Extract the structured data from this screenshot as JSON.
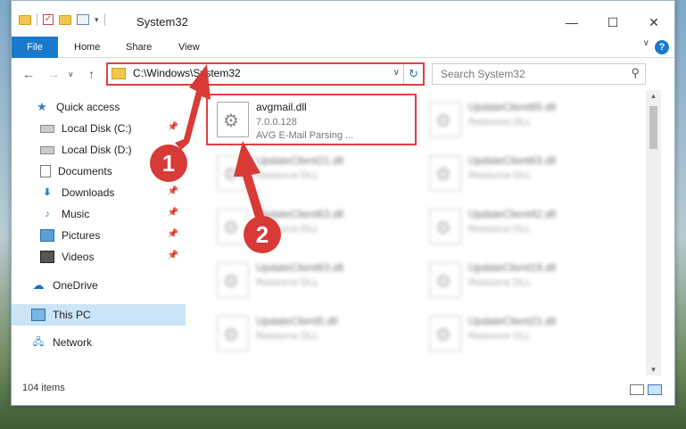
{
  "window": {
    "title": "System32",
    "minimize": "—",
    "maximize": "☐",
    "close": "✕"
  },
  "ribbon": {
    "tabs": [
      "File",
      "Home",
      "Share",
      "View"
    ],
    "help": "?",
    "expand": "∨"
  },
  "address": {
    "path": "C:\\Windows\\System32",
    "dropdown": "∨",
    "refresh": "↻"
  },
  "nav_buttons": {
    "back": "←",
    "forward": "→",
    "recent": "∨",
    "up": "↑"
  },
  "search": {
    "placeholder": "Search System32",
    "icon": "search-icon"
  },
  "navpane": {
    "items": [
      {
        "label": "Quick access",
        "icon": "star-icon",
        "pinned": false
      },
      {
        "label": "Local Disk (C:)",
        "icon": "disk-icon",
        "pinned": true
      },
      {
        "label": "Local Disk (D:)",
        "icon": "disk-icon",
        "pinned": false
      },
      {
        "label": "Documents",
        "icon": "documents-icon",
        "pinned": true
      },
      {
        "label": "Downloads",
        "icon": "download-icon",
        "pinned": true
      },
      {
        "label": "Music",
        "icon": "music-icon",
        "pinned": true
      },
      {
        "label": "Pictures",
        "icon": "pictures-icon",
        "pinned": true
      },
      {
        "label": "Videos",
        "icon": "videos-icon",
        "pinned": true
      },
      {
        "label": "OneDrive",
        "icon": "cloud-icon",
        "pinned": false
      },
      {
        "label": "This PC",
        "icon": "pc-icon",
        "pinned": false,
        "selected": true
      },
      {
        "label": "Network",
        "icon": "network-icon",
        "pinned": false
      }
    ]
  },
  "files": [
    {
      "name": "avgmail.dll",
      "line2": "7.0.0.128",
      "line3": "AVG E-Mail Parsing ...",
      "highlighted": true
    },
    {
      "name": "UpdateClient65.dll",
      "line2": "Resource DLL"
    },
    {
      "name": "UpdateClient21.dll",
      "line2": "Resource DLL"
    },
    {
      "name": "UpdateClient63.dll",
      "line2": "Resource DLL"
    },
    {
      "name": "UpdateClient63.dll",
      "line2": "Resource DLL"
    },
    {
      "name": "UpdateClient42.dll",
      "line2": "Resource DLL"
    },
    {
      "name": "UpdateClient63.dll",
      "line2": "Resource DLL"
    },
    {
      "name": "UpdateClient19.dll",
      "line2": "Resource DLL"
    },
    {
      "name": "UpdateClient5.dll",
      "line2": "Resource DLL"
    },
    {
      "name": "UpdateClient21.dll",
      "line2": "Resource DLL"
    }
  ],
  "status": {
    "item_count": "104 items"
  },
  "annotations": {
    "step1": "1",
    "step2": "2",
    "color": "#d83a37"
  },
  "colors": {
    "accent": "#1979ca",
    "highlight_border": "#e0403e",
    "selection": "#cce4f7"
  }
}
